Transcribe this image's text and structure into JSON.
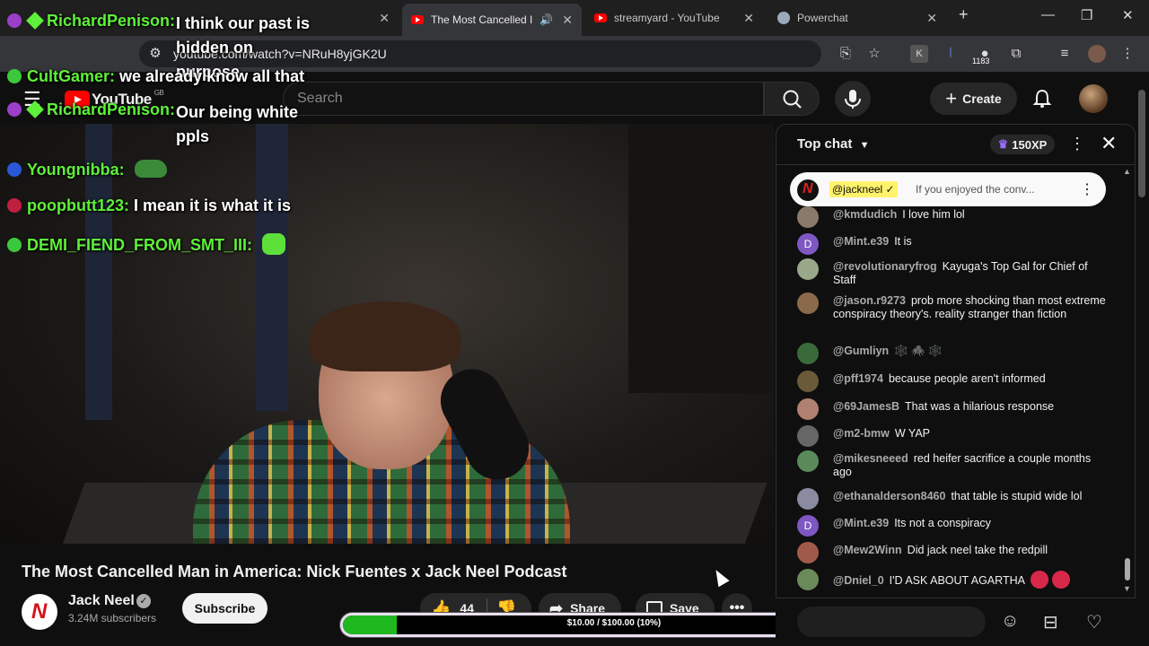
{
  "browser": {
    "tabs": [
      {
        "label": "",
        "active": false
      },
      {
        "label": "",
        "active": false
      },
      {
        "label": "The Most Cancelled I",
        "active": true
      },
      {
        "label": "streamyard - YouTube",
        "active": false
      },
      {
        "label": "Powerchat",
        "active": false
      }
    ],
    "url": "youtube.com/watch?v=NRuH8yjGK2U",
    "extension_badge": "1183"
  },
  "youtube": {
    "logo_text": "YouTube",
    "region": "GB",
    "search_placeholder": "Search",
    "create_label": "Create"
  },
  "overlay_chat": [
    {
      "user": "RichardPenison:",
      "text": "I think our past is hidden on purpose",
      "badge": "purple"
    },
    {
      "user": "CultGamer:",
      "text": "we already know all that",
      "badge": "green"
    },
    {
      "user": "RichardPenison:",
      "text": "Our being white ppls",
      "badge": "purple"
    },
    {
      "user": "Youngnibba:",
      "text": "",
      "badge": "blue"
    },
    {
      "user": "poopbutt123:",
      "text": "I mean it is what it is",
      "badge": "red"
    },
    {
      "user": "DEMI_FIEND_FROM_SMT_III:",
      "text": "",
      "badge": "green"
    }
  ],
  "video": {
    "title": "The Most Cancelled Man in America: Nick Fuentes x Jack Neel Podcast",
    "channel": "Jack Neel",
    "subscribers": "3.24M subscribers",
    "subscribe_label": "Subscribe",
    "likes": "44",
    "share_label": "Share",
    "save_label": "Save"
  },
  "donation_goal": {
    "text": "$10.00 / $100.00 (10%)",
    "progress": 0.1
  },
  "live_chat": {
    "mode_label": "Top chat",
    "xp_label": "150XP",
    "pinned": {
      "author": "@jackneel ✓",
      "text": "If you enjoyed the conv..."
    },
    "messages": [
      {
        "author": "@kmdudich",
        "text": "I love him lol",
        "avatar_color": "#8a7a6a"
      },
      {
        "author": "@Mint.e39",
        "text": "It is",
        "avatar_color": "#7e57c2",
        "initial": "D"
      },
      {
        "author": "@revolutionaryfrog",
        "text": "Kayuga's Top Gal for Chief of Staff",
        "avatar_color": "#9aa88a"
      },
      {
        "author": "@jason.r9273",
        "text": "prob more shocking than most extreme conspiracy theory's. reality stranger than fiction",
        "avatar_color": "#8a6a4a"
      },
      {
        "author": "@Gumliyn",
        "text": "🕸️ 🕷️ 🕸️",
        "avatar_color": "#3a6a3a"
      },
      {
        "author": "@pff1974",
        "text": "because people aren't informed",
        "avatar_color": "#6a5a3a"
      },
      {
        "author": "@69JamesB",
        "text": "That was a hilarious response",
        "avatar_color": "#b08070"
      },
      {
        "author": "@m2-bmw",
        "text": "W YAP",
        "avatar_color": "#666"
      },
      {
        "author": "@mikesneeed",
        "text": "red heifer sacrifice a couple months ago",
        "avatar_color": "#5a8a5a"
      },
      {
        "author": "@ethanalderson8460",
        "text": "that table is stupid wide lol",
        "avatar_color": "#8a8aa0"
      },
      {
        "author": "@Mint.e39",
        "text": "Its not a conspiracy",
        "avatar_color": "#7e57c2",
        "initial": "D"
      },
      {
        "author": "@Mew2Winn",
        "text": "Did jack neel take the redpill",
        "avatar_color": "#a05a4a"
      },
      {
        "author": "@Dniel_0",
        "text": "I'D ASK ABOUT AGARTHA",
        "avatar_color": "#6a8a5a"
      }
    ]
  },
  "colors": {
    "overlay_name": "#5ef03a",
    "goal_fill": "#1fb81f",
    "youtube_red": "#ff0000"
  }
}
